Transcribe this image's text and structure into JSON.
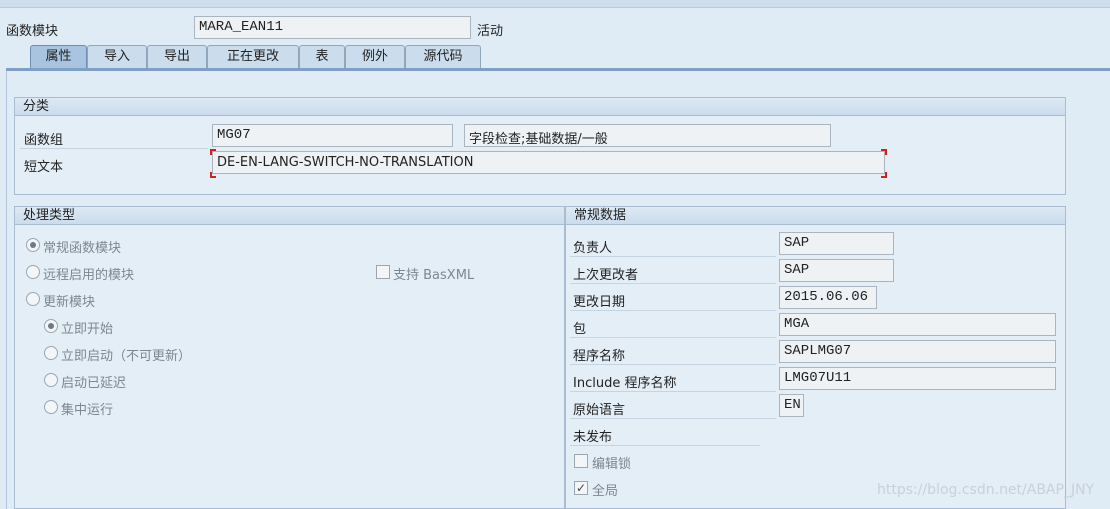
{
  "header": {
    "func_module_label": "函数模块",
    "func_module_value": "MARA_EAN11",
    "status": "活动"
  },
  "tabs": [
    {
      "label": "属性",
      "active": true
    },
    {
      "label": "导入",
      "active": false
    },
    {
      "label": "导出",
      "active": false
    },
    {
      "label": "正在更改",
      "active": false
    },
    {
      "label": "表",
      "active": false
    },
    {
      "label": "例外",
      "active": false
    },
    {
      "label": "源代码",
      "active": false
    }
  ],
  "classification": {
    "title": "分类",
    "function_group_label": "函数组",
    "function_group_value": "MG07",
    "function_group_desc": "字段检查;基础数据/一般",
    "short_text_label": "短文本",
    "short_text_value": "DE-EN-LANG-SWITCH-NO-TRANSLATION"
  },
  "processing": {
    "title": "处理类型",
    "normal_module": "常规函数模块",
    "remote_enabled": "远程启用的模块",
    "basxml": "支持 BasXML",
    "update_module": "更新模块",
    "start_immediately": "立即开始",
    "immediate_no_update": "立即启动（不可更新）",
    "start_delayed": "启动已延迟",
    "collective_run": "集中运行"
  },
  "general": {
    "title": "常规数据",
    "responsible_label": "负责人",
    "responsible_value": "SAP",
    "last_changed_by_label": "上次更改者",
    "last_changed_by_value": "SAP",
    "changed_on_label": "更改日期",
    "changed_on_value": "2015.06.06",
    "package_label": "包",
    "package_value": "MGA",
    "program_label": "程序名称",
    "program_value": "SAPLMG07",
    "include_label": "Include 程序名称",
    "include_value": "LMG07U11",
    "orig_lang_label": "原始语言",
    "orig_lang_value": "EN",
    "not_released": "未发布",
    "edit_lock": "编辑锁",
    "global": "全局"
  },
  "watermark": "https://blog.csdn.net/ABAP_JNY"
}
